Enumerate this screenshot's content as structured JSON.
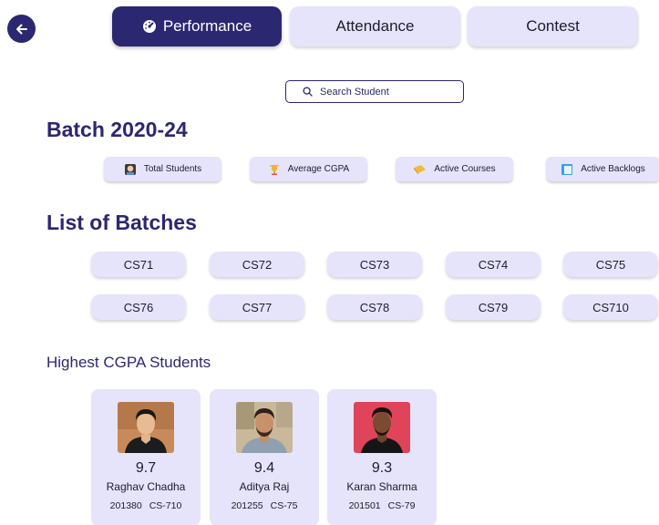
{
  "nav": {
    "back_icon": "arrow-left-icon",
    "tabs": [
      {
        "label": "Performance",
        "active": true,
        "icon": "dashboard-gauge-icon"
      },
      {
        "label": "Attendance",
        "active": false
      },
      {
        "label": "Contest",
        "active": false
      }
    ]
  },
  "search": {
    "placeholder": "Search Student",
    "value": "",
    "icon": "search-icon"
  },
  "batch_section": {
    "title": "Batch 2020-24",
    "stats": [
      {
        "label": "Total Students",
        "icon": "student-icon"
      },
      {
        "label": "Average CGPA",
        "icon": "trophy-icon"
      },
      {
        "label": "Active Courses",
        "icon": "book-icon"
      },
      {
        "label": "Active Backlogs",
        "icon": "document-icon"
      }
    ]
  },
  "batches_section": {
    "title": "List of Batches",
    "batches": [
      "CS71",
      "CS72",
      "CS73",
      "CS74",
      "CS75",
      "CS76",
      "CS77",
      "CS78",
      "CS79",
      "CS710"
    ]
  },
  "highest_section": {
    "title": "Highest CGPA Students",
    "students": [
      {
        "cgpa": "9.7",
        "name": "Raghav Chadha",
        "id": "201380",
        "batch": "CS-710"
      },
      {
        "cgpa": "9.4",
        "name": "Aditya Raj",
        "id": "201255",
        "batch": "CS-75"
      },
      {
        "cgpa": "9.3",
        "name": "Karan Sharma",
        "id": "201501",
        "batch": "CS-79"
      }
    ]
  },
  "colors": {
    "primary": "#2b2770",
    "chip_bg": "#e6e4fb",
    "background": "#ffffff"
  }
}
